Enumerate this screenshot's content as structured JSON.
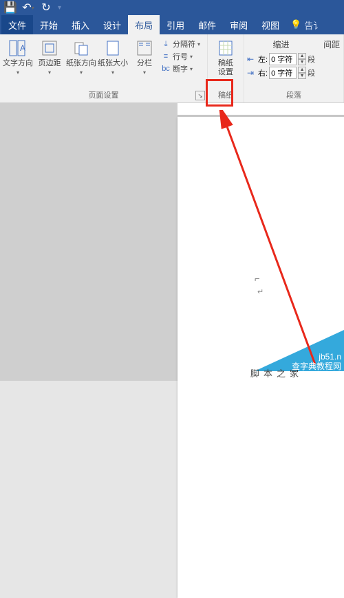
{
  "qat": {
    "save": "💾",
    "undo": "↶",
    "redo": "↻"
  },
  "tabs": {
    "file": "文件",
    "home": "开始",
    "insert": "插入",
    "design": "设计",
    "layout": "布局",
    "references": "引用",
    "mailings": "邮件",
    "review": "审阅",
    "view": "视图",
    "tell_me": "告讠"
  },
  "ribbon": {
    "text_direction": "文字方向",
    "margins": "页边距",
    "orientation": "纸张方向",
    "size": "纸张大小",
    "columns": "分栏",
    "breaks": "分隔符",
    "line_numbers": "行号",
    "hyphenation": "断字",
    "page_setup_group": "页面设置",
    "manuscript": "稿纸\n设置",
    "manuscript_group": "稿纸",
    "indent_header": "缩进",
    "indent_left_label": "左:",
    "indent_left_value": "0 字符",
    "indent_right_label": "右:",
    "indent_right_value": "0 字符",
    "spacing_header": "间距",
    "spacing_tail": "段",
    "paragraph_group": "段落"
  },
  "watermark": {
    "url": "jb51.n",
    "site": "查字典教程网"
  },
  "footer": "脚本之家"
}
